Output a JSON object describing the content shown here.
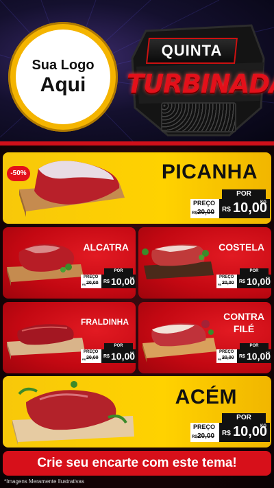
{
  "logo": {
    "line1": "Sua Logo",
    "line2": "Aqui"
  },
  "badge": {
    "top": "QUINTA",
    "bottom": "TURBINADA"
  },
  "products": [
    {
      "name": "PICANHA",
      "discount": "-50%",
      "por": "POR",
      "preco_label": "PREÇO",
      "currency_old": "R$",
      "old_price": "20,00",
      "currency": "R$",
      "price": "10,00",
      "unit": "KG"
    },
    {
      "name": "ALCATRA",
      "por": "POR",
      "preco_label": "PREÇO",
      "currency_old": "R$",
      "old_price": "20,00",
      "currency": "R$",
      "price": "10,00",
      "unit": "KG"
    },
    {
      "name": "COSTELA",
      "por": "POR",
      "preco_label": "PREÇO",
      "currency_old": "R$",
      "old_price": "20,00",
      "currency": "R$",
      "price": "10,00",
      "unit": "KG"
    },
    {
      "name": "FRALDINHA",
      "por": "POR",
      "preco_label": "PREÇO",
      "currency_old": "R$",
      "old_price": "20,00",
      "currency": "R$",
      "price": "10,00",
      "unit": "KG"
    },
    {
      "name_line1": "CONTRA",
      "name_line2": "FILÉ",
      "por": "POR",
      "preco_label": "PREÇO",
      "currency_old": "R$",
      "old_price": "20,00",
      "currency": "R$",
      "price": "10,00",
      "unit": "KG"
    },
    {
      "name": "ACÉM",
      "por": "POR",
      "preco_label": "PREÇO",
      "currency_old": "R$",
      "old_price": "20,00",
      "currency": "R$",
      "price": "10,00",
      "unit": "KG"
    }
  ],
  "cta": "Crie seu encarte com este tema!",
  "disclaimer": "*Imagens Meramente Ilustrativas",
  "colors": {
    "yellow": "#f7c80a",
    "red": "#d7101a",
    "dark": "#111111"
  }
}
